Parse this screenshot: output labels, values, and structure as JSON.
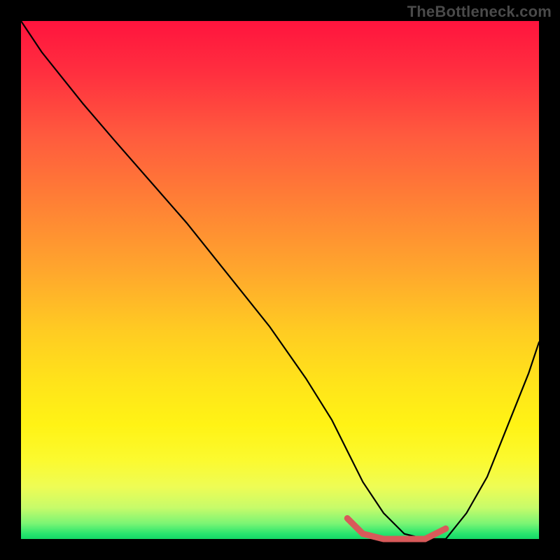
{
  "watermark": "TheBottleneck.com",
  "chart_data": {
    "type": "line",
    "title": "",
    "xlabel": "",
    "ylabel": "",
    "xlim": [
      0,
      100
    ],
    "ylim": [
      0,
      100
    ],
    "grid": false,
    "series": [
      {
        "name": "bottleneck-curve",
        "color": "#000000",
        "x": [
          0,
          4,
          8,
          12,
          18,
          25,
          32,
          40,
          48,
          55,
          60,
          63,
          66,
          70,
          74,
          78,
          82,
          86,
          90,
          94,
          98,
          100
        ],
        "y": [
          100,
          94,
          89,
          84,
          77,
          69,
          61,
          51,
          41,
          31,
          23,
          17,
          11,
          5,
          1,
          0,
          0,
          5,
          12,
          22,
          32,
          38
        ]
      },
      {
        "name": "min-highlight",
        "color": "#d85a5a",
        "x": [
          63,
          66,
          70,
          74,
          78,
          82
        ],
        "y": [
          4,
          1,
          0,
          0,
          0,
          2
        ]
      }
    ],
    "gradient_stops": [
      {
        "pos": 0.0,
        "color": "#ff143e"
      },
      {
        "pos": 0.35,
        "color": "#ff8035"
      },
      {
        "pos": 0.7,
        "color": "#ffe41a"
      },
      {
        "pos": 0.9,
        "color": "#eefc55"
      },
      {
        "pos": 1.0,
        "color": "#14d766"
      }
    ]
  }
}
